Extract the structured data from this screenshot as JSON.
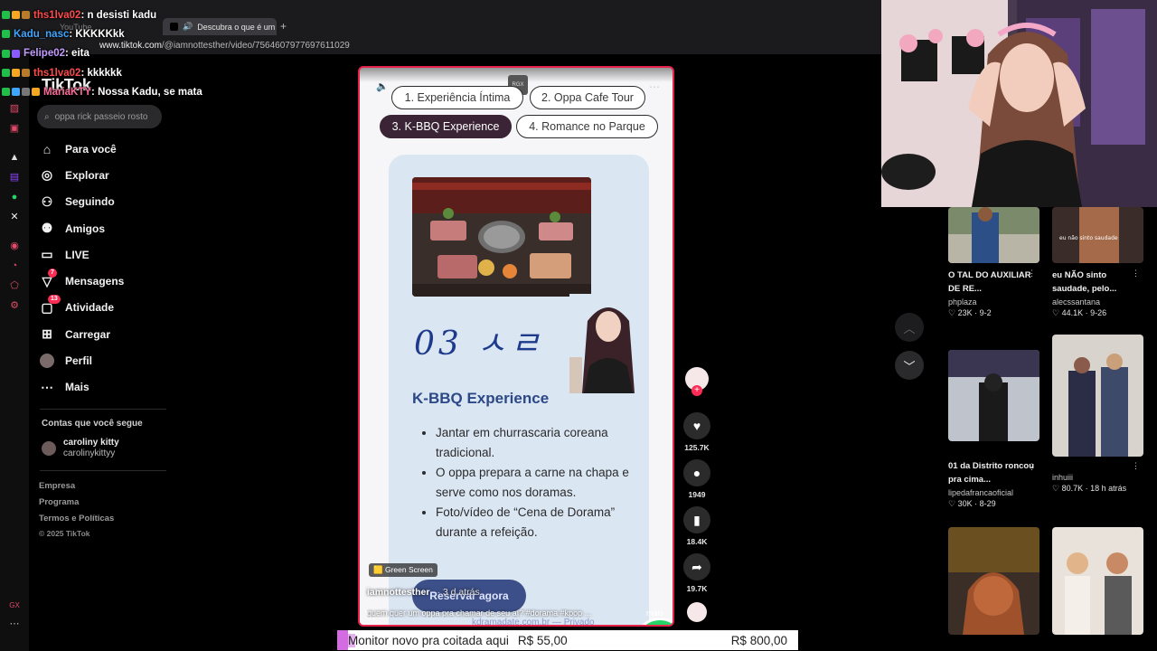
{
  "browser": {
    "tab_label": "Descubra o que é um",
    "ghost_tab": "YouTube",
    "url_host": "www.tiktok.com",
    "url_path": "/@iamnottesther/video/7564607977697611029"
  },
  "chat": [
    {
      "user": "ths1lva02",
      "message": ": n desisti kadu",
      "color": "#ff4a4a"
    },
    {
      "user": "Kadu_nasc",
      "message": ": KKKKKkk",
      "color": "#3fa6ff"
    },
    {
      "user": "Felipe02",
      "message": ": eita",
      "color": "#c39bff"
    },
    {
      "user": "ths1lva02",
      "message": ": kkkkkk",
      "color": "#ff4a4a"
    },
    {
      "user": "MariaKTY",
      "message": ": Nossa Kadu, se mata",
      "color": "#ff6b9a"
    }
  ],
  "tiktok": {
    "logo": "TikTok",
    "search_placeholder": "oppa rick passeio rosto",
    "nav": [
      {
        "label": "Para você",
        "icon": "home-icon",
        "glyph": "⌂"
      },
      {
        "label": "Explorar",
        "icon": "compass-icon",
        "glyph": "◎"
      },
      {
        "label": "Seguindo",
        "icon": "following-icon",
        "glyph": "⚇"
      },
      {
        "label": "Amigos",
        "icon": "friends-icon",
        "glyph": "⚉"
      },
      {
        "label": "LIVE",
        "icon": "live-icon",
        "glyph": "▭"
      },
      {
        "label": "Mensagens",
        "icon": "messages-icon",
        "glyph": "▽",
        "badge": "7"
      },
      {
        "label": "Atividade",
        "icon": "activity-icon",
        "glyph": "▢",
        "badge": "13"
      },
      {
        "label": "Carregar",
        "icon": "upload-icon",
        "glyph": "⊞"
      },
      {
        "label": "Perfil",
        "icon": "profile-avatar",
        "glyph": "●"
      },
      {
        "label": "Mais",
        "icon": "more-icon",
        "glyph": "⋯"
      }
    ],
    "following_title": "Contas que você segue",
    "following": {
      "name": "caroliny kitty",
      "user": "carolinykittyy"
    },
    "footer": [
      "Empresa",
      "Programa",
      "Termos e Políticas"
    ],
    "copyright": "© 2025 TikTok"
  },
  "video": {
    "pills": [
      "1. Experiência Íntima",
      "2. Oppa Cafe Tour",
      "3. K-BBQ Experience",
      "4. Romance no Parque"
    ],
    "handwritten": "03 ㅅㄹ",
    "title": "K-BBQ Experience",
    "bullets": [
      "Jantar em churrascaria coreana tradicional.",
      "O oppa prepara a carne na chapa e serve como nos doramas.",
      "Foto/vídeo de “Cena de Dorama” durante a refeição."
    ],
    "reserve_label": "Reservar agora",
    "effect_tag": "Green Screen",
    "author": "iamnottesther",
    "time": "· 3 d atrás",
    "caption": "quem quer um oppa pra chamar de seu aí? #dorama #kpop ...",
    "more": "mais",
    "site_url": "kdramadate.com.br — Privado",
    "rgx_label": "RGX"
  },
  "actions": {
    "likes": "125.7K",
    "comments": "1949",
    "saves": "18.4K",
    "shares": "19.7K"
  },
  "grid": [
    {
      "title": "O TAL DO AUXILIAR DE RE...",
      "user": "phplaza",
      "likes": "23K",
      "date": "9-2"
    },
    {
      "title": "eu NÃO sinto saudade, pelo...",
      "user": "alecssantana",
      "likes": "44.1K",
      "date": "9-26"
    },
    {
      "title": "01 da Distrito roncou pra cima...",
      "user": "lipedafrancaoficial",
      "likes": "30K",
      "date": "8-29"
    },
    {
      "title": "",
      "user": "inhuiii",
      "likes": "80.7K",
      "date": "18 h atrás"
    }
  ],
  "donation": {
    "message": "Monitor novo pra coitada aqui",
    "amount": "R$ 55,00",
    "goal": "R$ 800,00"
  },
  "colors": {
    "accent": "#fe2c55",
    "video_border": "#e4224a",
    "card_bg": "#dbe6f3",
    "title_blue": "#2c4886"
  }
}
